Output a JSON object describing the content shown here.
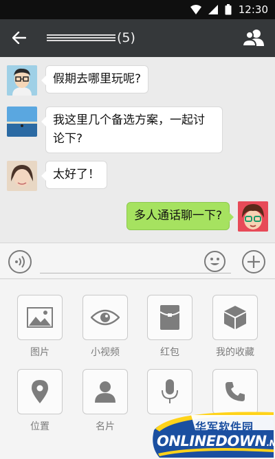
{
  "status_bar": {
    "time": "12:30"
  },
  "header": {
    "member_count": "(5)"
  },
  "messages": [
    {
      "side": "left",
      "text": "假期去哪里玩呢?"
    },
    {
      "side": "left",
      "text": "我这里几个备选方案，一起讨论下?"
    },
    {
      "side": "left",
      "text": "太好了！"
    },
    {
      "side": "right",
      "text": "多人通话聊一下?"
    }
  ],
  "input": {
    "value": "",
    "placeholder": ""
  },
  "tools": [
    {
      "label": "图片",
      "icon": "image-icon"
    },
    {
      "label": "小视频",
      "icon": "eye-icon"
    },
    {
      "label": "红包",
      "icon": "red-envelope-icon"
    },
    {
      "label": "我的收藏",
      "icon": "favorites-cube-icon"
    },
    {
      "label": "位置",
      "icon": "location-pin-icon"
    },
    {
      "label": "名片",
      "icon": "contact-card-icon"
    },
    {
      "label": "",
      "icon": "microphone-icon"
    },
    {
      "label": "",
      "icon": "phone-icon"
    }
  ],
  "watermark": {
    "title": "华军软件园",
    "brand": "ONLINEDOWN",
    "suffix": ".NET"
  },
  "colors": {
    "header": "#35383a",
    "sent_bubble": "#a6e260",
    "watermark_blue": "#1b4fa0"
  }
}
